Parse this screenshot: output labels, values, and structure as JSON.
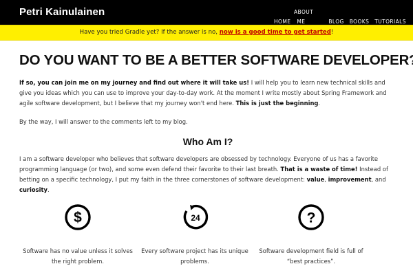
{
  "header": {
    "brand": "Petri Kainulainen",
    "nav": {
      "about": "ABOUT",
      "home": "HOME",
      "me": "ME",
      "blog": "BLOG",
      "books": "BOOKS",
      "tutorials": "TUTORIALS"
    }
  },
  "notice": {
    "prefix": "Have you tried Gradle yet? If the answer is no, ",
    "link": "now is a good time to get started",
    "suffix": "!"
  },
  "main": {
    "headline": "DO YOU WANT TO BE A BETTER SOFTWARE DEVELOPER?",
    "p1": {
      "bold_intro": "If so, you can join me on my journey and find out where it will take us!",
      "text": " I will help you to learn new technical skills and give you ideas which you can use to improve your day-to-day work. At the moment I write mostly about Spring Framework and agile software development, but I believe that my journey won't end here. ",
      "bold_end": "This is just the beginning",
      "end": "."
    },
    "p2": "By the way, I will answer to the comments left to my blog.",
    "section_title": "Who Am I?",
    "p3": {
      "text1": "I am a software developer who believes that software developers are obsessed by technology. Everyone of us has a favorite programming language (or two), and some even defend their favorite to their last breath. ",
      "bold1": "That is a waste of time!",
      "text2": " Instead of betting on a specific technology, I put my faith in the three cornerstones of software development: ",
      "value": "value",
      "sep1": ", ",
      "improvement": "improvement",
      "sep2": ", and ",
      "curiosity": "curiosity",
      "end": "."
    }
  },
  "features": [
    {
      "icon": "dollar-icon",
      "text": "Software has no value unless it solves the right problem."
    },
    {
      "icon": "clock-24-icon",
      "icon_label": "24",
      "text": "Every software project has its unique problems."
    },
    {
      "icon": "question-icon",
      "text": "Software development field is full of “best practices”."
    }
  ]
}
